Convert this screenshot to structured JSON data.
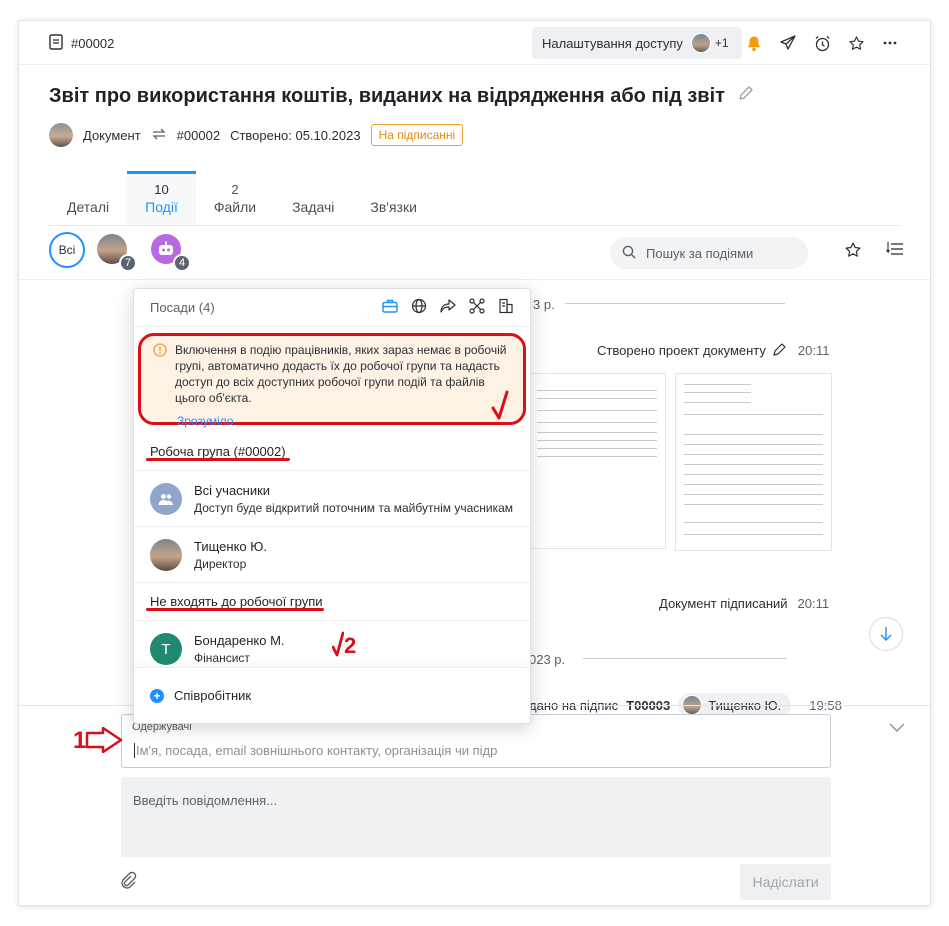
{
  "header": {
    "doc_id": "#00002",
    "access_button": "Налаштування доступу",
    "access_extra": "+1"
  },
  "title": "Звіт про використання коштів, виданих на відрядження або під звіт",
  "meta": {
    "type": "Документ",
    "number": "#00002",
    "created": "Створено: 05.10.2023",
    "status": "На підписанні"
  },
  "tabs": [
    {
      "count": "",
      "label": "Деталі"
    },
    {
      "count": "10",
      "label": "Події"
    },
    {
      "count": "2",
      "label": "Файли"
    },
    {
      "count": "",
      "label": "Задачі"
    },
    {
      "count": "",
      "label": "Зв'язки"
    }
  ],
  "filters": {
    "all": "Всі",
    "user_count": "7",
    "bot_count": "4",
    "search_placeholder": "Пошук за подіями"
  },
  "feed": {
    "date_partial_1": "3 р.",
    "event_created": "Створено проект документу",
    "event_created_time": "20:11",
    "event_signed": "Документ підписаний",
    "event_signed_time": "20:11",
    "date_partial_2": "023 р.",
    "pending_text": "дано на підпис",
    "pending_code": "Т00003",
    "pending_person": "Тищенко Ю.",
    "pending_time": "19:58"
  },
  "popup": {
    "title": "Посади (4)",
    "warning": "Включення в подію працівників, яких зараз немає в робочій групі, автоматично додасть їх до робочої групи та надасть доступ до всіх доступних робочої групи подій та файлів цього об'єкта.",
    "ok": "Зрозуміло",
    "group_heading": "Робоча група (#00002)",
    "members": [
      {
        "name": "Всі учасники",
        "sub": "Доступ буде відкритий поточним та майбутнім учасникам"
      },
      {
        "name": "Тищенко Ю.",
        "sub": "Директор"
      }
    ],
    "outside_heading": "Не входять до робочої групи",
    "outside": [
      {
        "initial": "Т",
        "name": "Бондаренко М.",
        "sub": "Фінансист"
      }
    ],
    "add_employee": "Співробітник"
  },
  "compose": {
    "recipients_label": "Одержувачі",
    "recipients_placeholder": "Ім'я, посада, email зовнішнього контакту, організація чи підр",
    "message_placeholder": "Введіть повідомлення...",
    "send": "Надіслати"
  },
  "annotations": {
    "marker_1": "1",
    "marker_2": "2"
  }
}
